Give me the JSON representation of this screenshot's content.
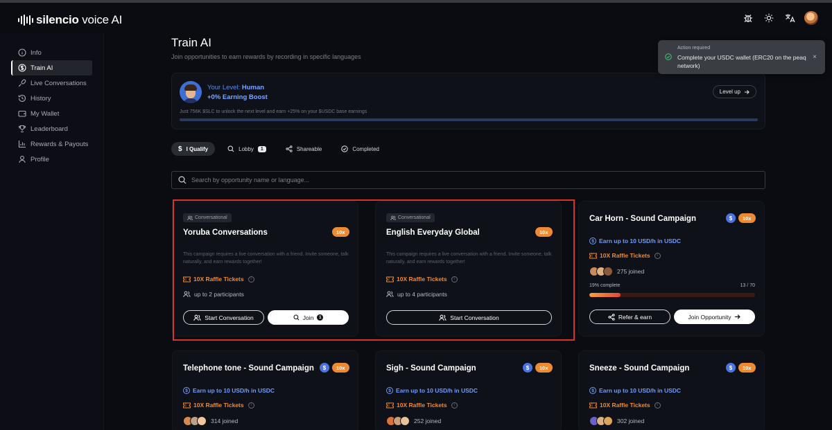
{
  "app": {
    "brand_bold": "silencio",
    "brand_thin": " voice AI"
  },
  "header_icons": [
    "bug-icon",
    "sun-icon",
    "translate-icon",
    "user-avatar"
  ],
  "sidebar": {
    "items": [
      {
        "label": "Info",
        "icon": "info-icon"
      },
      {
        "label": "Train AI",
        "icon": "dollar-circle-icon",
        "active": true
      },
      {
        "label": "Live Conversations",
        "icon": "microphone-icon"
      },
      {
        "label": "History",
        "icon": "history-icon"
      },
      {
        "label": "My Wallet",
        "icon": "wallet-icon"
      },
      {
        "label": "Leaderboard",
        "icon": "trophy-icon"
      },
      {
        "label": "Rewards & Payouts",
        "icon": "bar-chart-icon"
      },
      {
        "label": "Profile",
        "icon": "user-icon"
      }
    ]
  },
  "page": {
    "title": "Train AI",
    "subtitle": "Join opportunities to earn rewards by recording in specific languages"
  },
  "level": {
    "prefix": "Your Level: ",
    "name": "Human",
    "boost": "+0% Earning Boost",
    "level_up": "Level up",
    "note": "Just 756K $SLC to unlock the next level and earn +25% on your $USDC base earnings"
  },
  "tabs": [
    {
      "label": "I Qualify",
      "icon": "dollar-icon",
      "active": true
    },
    {
      "label": "Lobby",
      "icon": "search-icon",
      "badge": "1"
    },
    {
      "label": "Shareable",
      "icon": "share-icon"
    },
    {
      "label": "Completed",
      "icon": "check-circle-icon"
    }
  ],
  "search": {
    "placeholder": "Search by opportunity name or language..."
  },
  "cards": [
    {
      "chip": "Conversational",
      "title": "Yoruba Conversations",
      "boost": "10x",
      "description": "This campaign requires a live conversation with a friend. Invite someone, talk naturally, and earn rewards together!",
      "raffle": "10X Raffle Tickets",
      "participants": "up to 2 participants",
      "btn_primary": "Start Conversation",
      "btn_secondary": "Join",
      "btn_secondary_count": "1"
    },
    {
      "chip": "Conversational",
      "title": "English Everyday Global",
      "boost": "10x",
      "description": "This campaign requires a live conversation with a friend. Invite someone, talk naturally, and earn rewards together!",
      "raffle": "10X Raffle Tickets",
      "participants": "up to 4 participants",
      "btn_primary": "Start Conversation"
    },
    {
      "title": "Car Horn - Sound Campaign",
      "usd": "$",
      "boost": "10x",
      "earn": "Earn up to 10 USD/h in USDC",
      "raffle": "10X Raffle Tickets",
      "joined": "275 joined",
      "progress_label": "19% complete",
      "progress_count": "13 / 70",
      "progress_fraction": 0.19,
      "btn_refer": "Refer & earn",
      "btn_join": "Join Opportunity"
    },
    {
      "title": "Telephone tone - Sound Campaign",
      "usd": "$",
      "boost": "10x",
      "earn": "Earn up to 10 USD/h in USDC",
      "raffle": "10X Raffle Tickets",
      "joined": "314 joined"
    },
    {
      "title": "Sigh - Sound Campaign",
      "usd": "$",
      "boost": "10x",
      "earn": "Earn up to 10 USD/h in USDC",
      "raffle": "10X Raffle Tickets",
      "joined": "252 joined"
    },
    {
      "title": "Sneeze - Sound Campaign",
      "usd": "$",
      "boost": "10x",
      "earn": "Earn up to 10 USD/h in USDC",
      "raffle": "10X Raffle Tickets",
      "joined": "302 joined"
    }
  ],
  "toast": {
    "heading": "Action required",
    "message": "Complete your USDC wallet (ERC20 on the peaq network)",
    "close": "×"
  },
  "colors": {
    "accent_orange": "#f08a32",
    "accent_blue": "#6f9cff",
    "highlight_red": "#d9342b",
    "success_green": "#3ec46d"
  }
}
